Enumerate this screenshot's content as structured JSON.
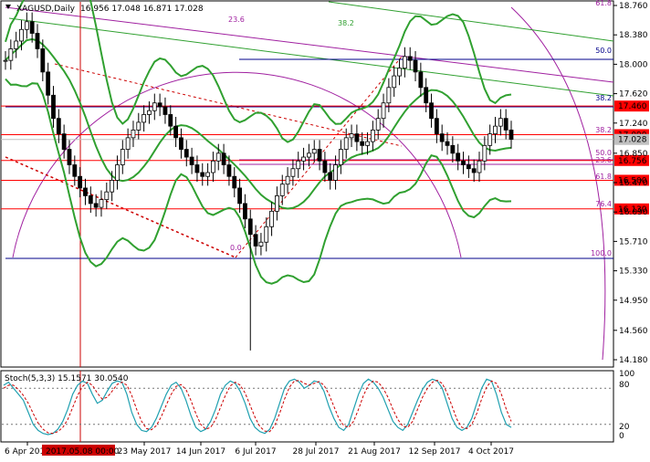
{
  "chart_data": {
    "type": "candlestick",
    "symbol_header": "XAGUSD,Daily",
    "ohlc_header": "16.956 17.048 16.871 17.028",
    "y_ticks": [
      "18.760",
      "18.380",
      "18.000",
      "17.620",
      "17.240",
      "16.850",
      "16.470",
      "16.090",
      "15.710",
      "15.330",
      "14.950",
      "14.560",
      "14.180"
    ],
    "x_ticks": [
      "6 Apr 2017",
      "23 May 2017",
      "14 Jun 2017",
      "6 Jul 2017",
      "28 Jul 2017",
      "21 Aug 2017",
      "12 Sep 2017",
      "4 Oct 2017"
    ],
    "crosshair_date": "2017.05.08 00:00",
    "price_range": [
      14.18,
      18.76
    ],
    "horizontal_levels": [
      {
        "price": 17.46,
        "label": "17.460",
        "color": "#ff0000"
      },
      {
        "price": 17.09,
        "label": "17.090",
        "color": "#ff0000"
      },
      {
        "price": 16.756,
        "label": "16.756",
        "color": "#ff0000"
      },
      {
        "price": 16.5,
        "label": "16.500",
        "color": "#ff0000"
      },
      {
        "price": 16.13,
        "label": "16.130",
        "color": "#ff0000"
      },
      {
        "price": 17.028,
        "label": "17.028",
        "color": "#c0c0c0"
      }
    ],
    "fibo_right_labels": [
      "61.8",
      "50.0",
      "38.2",
      "38.2",
      "50.0",
      "23.6",
      "61.8",
      "76.4",
      "100.0"
    ],
    "fibo_inner_labels": [
      "23.6",
      "38.2",
      "0.0"
    ],
    "closes": [
      18.05,
      18.2,
      18.3,
      18.45,
      18.55,
      18.4,
      18.2,
      17.9,
      17.6,
      17.3,
      17.1,
      16.9,
      16.7,
      16.55,
      16.4,
      16.3,
      16.2,
      16.15,
      16.25,
      16.35,
      16.5,
      16.7,
      16.9,
      17.05,
      17.15,
      17.25,
      17.35,
      17.4,
      17.5,
      17.45,
      17.35,
      17.2,
      17.05,
      16.9,
      16.8,
      16.7,
      16.6,
      16.55,
      16.6,
      16.75,
      16.85,
      16.7,
      16.55,
      16.4,
      16.2,
      16.0,
      15.8,
      15.65,
      15.7,
      15.9,
      16.1,
      16.3,
      16.45,
      16.55,
      16.65,
      16.75,
      16.8,
      16.85,
      16.9,
      16.75,
      16.6,
      16.5,
      16.7,
      16.9,
      17.05,
      17.1,
      17.0,
      16.95,
      17.0,
      17.15,
      17.3,
      17.5,
      17.7,
      17.85,
      17.95,
      18.1,
      18.05,
      17.9,
      17.7,
      17.5,
      17.3,
      17.1,
      17.0,
      16.95,
      16.85,
      16.75,
      16.7,
      16.65,
      16.6,
      16.75,
      16.95,
      17.1,
      17.2,
      17.3,
      17.15,
      17.03
    ],
    "stoch_header": "Stoch(5,3,3) 15.1571 30.0540",
    "stoch_levels": [
      "100",
      "80",
      "20",
      "0"
    ],
    "stoch_k": [
      85,
      90,
      80,
      70,
      60,
      40,
      20,
      10,
      5,
      3,
      5,
      12,
      25,
      45,
      70,
      85,
      92,
      88,
      70,
      55,
      60,
      75,
      88,
      92,
      90,
      70,
      40,
      20,
      10,
      8,
      15,
      30,
      50,
      70,
      85,
      90,
      80,
      60,
      35,
      15,
      8,
      12,
      25,
      45,
      70,
      85,
      92,
      88,
      75,
      55,
      30,
      15,
      8,
      5,
      12,
      30,
      55,
      80,
      92,
      95,
      90,
      80,
      85,
      92,
      90,
      75,
      50,
      30,
      15,
      10,
      20,
      45,
      70,
      88,
      95,
      90,
      80,
      65,
      45,
      25,
      15,
      10,
      20,
      40,
      60,
      78,
      90,
      95,
      92,
      80,
      55,
      30,
      15,
      10,
      15,
      30,
      55,
      80,
      95,
      92,
      70,
      40,
      20,
      15
    ],
    "stoch_d": [
      80,
      85,
      85,
      78,
      68,
      55,
      38,
      22,
      12,
      6,
      5,
      8,
      15,
      28,
      48,
      68,
      83,
      90,
      85,
      72,
      62,
      65,
      75,
      86,
      90,
      85,
      68,
      45,
      25,
      13,
      11,
      18,
      33,
      52,
      70,
      83,
      86,
      78,
      60,
      38,
      20,
      12,
      15,
      28,
      48,
      68,
      84,
      90,
      85,
      72,
      52,
      32,
      16,
      9,
      8,
      18,
      38,
      62,
      82,
      92,
      93,
      88,
      85,
      88,
      91,
      85,
      70,
      50,
      30,
      18,
      15,
      25,
      45,
      68,
      85,
      92,
      90,
      80,
      65,
      45,
      28,
      17,
      15,
      25,
      45,
      65,
      80,
      90,
      93,
      88,
      72,
      50,
      28,
      15,
      13,
      20,
      38,
      62,
      82,
      92,
      88,
      70,
      45,
      25
    ]
  }
}
